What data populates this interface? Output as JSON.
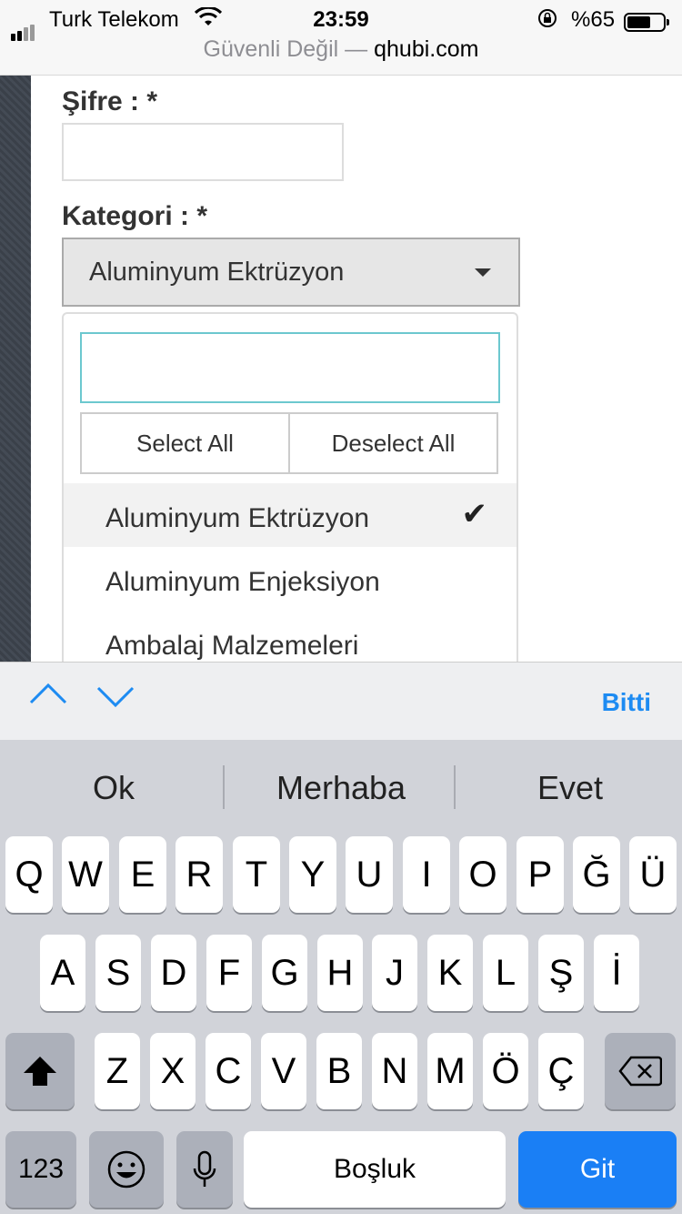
{
  "status_bar": {
    "carrier": "Turk Telekom",
    "time": "23:59",
    "battery_percent": "%65",
    "battery_level": 0.65
  },
  "url_bar": {
    "security_label": "Güvenli Değil —",
    "domain": "qhubi.com"
  },
  "form": {
    "password_label": "Şifre : *",
    "category_label": "Kategori : *",
    "category_selected": "Aluminyum Ektrüzyon"
  },
  "dropdown": {
    "search_value": "",
    "select_all_label": "Select All",
    "deselect_all_label": "Deselect All",
    "options": [
      {
        "label": "Aluminyum Ektrüzyon",
        "selected": true
      },
      {
        "label": "Aluminyum Enjeksiyon",
        "selected": false
      },
      {
        "label": "Ambalaj Malzemeleri",
        "selected": false
      }
    ]
  },
  "accessory": {
    "done_label": "Bitti"
  },
  "keyboard": {
    "suggestions": [
      "Ok",
      "Merhaba",
      "Evet"
    ],
    "row1": [
      "Q",
      "W",
      "E",
      "R",
      "T",
      "Y",
      "U",
      "I",
      "O",
      "P",
      "Ğ",
      "Ü"
    ],
    "row2": [
      "A",
      "S",
      "D",
      "F",
      "G",
      "H",
      "J",
      "K",
      "L",
      "Ş",
      "İ"
    ],
    "row3": [
      "Z",
      "X",
      "C",
      "V",
      "B",
      "N",
      "M",
      "Ö",
      "Ç"
    ],
    "numbers_label": "123",
    "space_label": "Boşluk",
    "go_label": "Git",
    "accent_color": "#1a7ff5"
  }
}
